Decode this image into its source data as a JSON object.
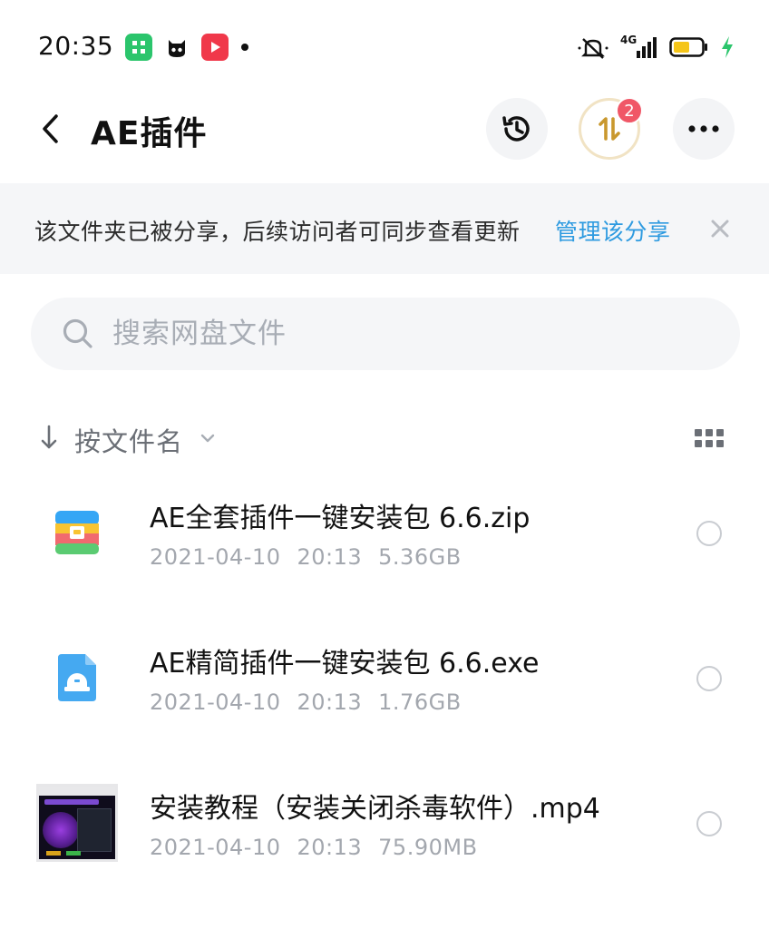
{
  "status_bar": {
    "time": "20:35",
    "network": "4G",
    "battery_color": "#f5c518",
    "charging_color": "#2bc56c"
  },
  "header": {
    "title": "AE插件",
    "transfer_badge": "2"
  },
  "share_banner": {
    "message": "该文件夹已被分享，后续访问者可同步查看更新",
    "action": "管理该分享"
  },
  "search": {
    "placeholder": "搜索网盘文件",
    "value": ""
  },
  "sort": {
    "label": "按文件名"
  },
  "files": [
    {
      "name": "AE全套插件一键安装包 6.6.zip",
      "date": "2021-04-10",
      "time": "20:13",
      "size": "5.36GB",
      "icon": "zip-archive-icon"
    },
    {
      "name": "AE精简插件一键安装包 6.6.exe",
      "date": "2021-04-10",
      "time": "20:13",
      "size": "1.76GB",
      "icon": "exe-installer-icon"
    },
    {
      "name": "安装教程（安装关闭杀毒软件）.mp4",
      "date": "2021-04-10",
      "time": "20:13",
      "size": "75.90MB",
      "icon": "video-thumbnail"
    }
  ],
  "colors": {
    "link": "#2f9be0",
    "badge": "#f05767",
    "banner_bg": "#f5f6f8",
    "meta_text": "#a3a7ae"
  }
}
